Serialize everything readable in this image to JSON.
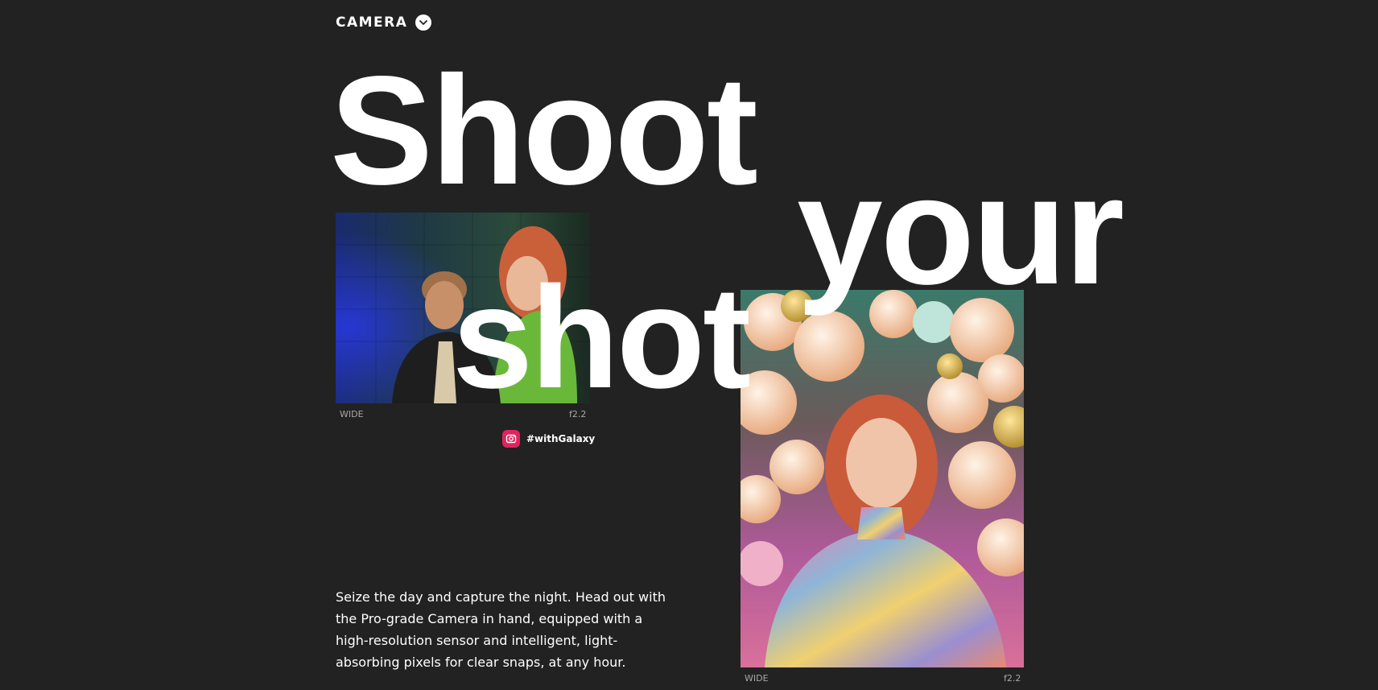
{
  "section": {
    "label": "CAMERA",
    "toggle_icon": "chevron-down-icon"
  },
  "headline": {
    "word_1": "Shoot",
    "word_2": "your",
    "word_3": "shot"
  },
  "photos": [
    {
      "lens": "WIDE",
      "aperture": "f2.2"
    },
    {
      "lens": "WIDE",
      "aperture": "f2.2"
    }
  ],
  "hashtag": {
    "icon": "instagram-icon",
    "text": "#withGalaxy"
  },
  "body_copy": "Seize the day and capture the night. Head out with the Pro-grade Camera in hand, equipped with a high-resolution sensor and intelligent, light-absorbing pixels for clear snaps, at any hour.",
  "colors": {
    "background": "#222222",
    "text": "#ffffff",
    "caption": "#a8a8a8",
    "instagram_accent": "#e0245e"
  }
}
